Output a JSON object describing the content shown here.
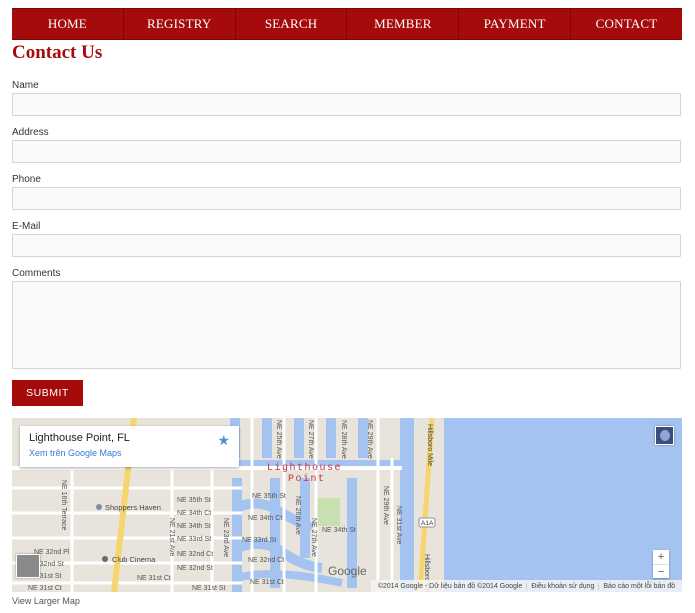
{
  "nav": {
    "items": [
      "HOME",
      "REGISTRY",
      "SEARCH",
      "MEMBER",
      "PAYMENT",
      "CONTACT"
    ]
  },
  "page_title": "Contact Us",
  "form": {
    "name_label": "Name",
    "address_label": "Address",
    "phone_label": "Phone",
    "email_label": "E-Mail",
    "comments_label": "Comments",
    "submit_label": "SUBMIT"
  },
  "map": {
    "card_title": "Lighthouse Point, FL",
    "card_link": "Xem trên Google Maps",
    "place_label_line1": "Lighthouse",
    "place_label_line2": "Point",
    "streets": {
      "ne_35th_st": "NE 35th St",
      "ne_34th_ct": "NE 34th Ct",
      "ne_34th_st": "NE 34th St",
      "ne_33rd_st": "NE 33rd St",
      "ne_32nd_ct": "NE 32nd Ct",
      "ne_32nd_st": "NE 32nd St",
      "ne_31st_ct": "NE 31st Ct",
      "ne_31st_st": "NE 31st St",
      "ne_32nd_pl": "NE 32nd Pl",
      "ne_16th_terrace": "NE 16th Terrace",
      "ne_21st_ave": "NE 21st Ave",
      "ne_23rd_ave": "NE 23rd Ave",
      "ne_25th_ave": "NE 25th Ave",
      "ne_26th_ave": "NE 26th Ave",
      "ne_27th_ave": "NE 27th Ave",
      "ne_28th_ave": "NE 28th Ave",
      "ne_29th_ave": "NE 29th Ave",
      "ne_31st_ave": "NE 31st Ave",
      "hillsboro_mile": "Hillsboro Mile",
      "a1a": "A1A"
    },
    "poi_shoppers_haven": "Shoppers Haven",
    "poi_club_cinema": "Club Cinema",
    "google_logo": "Google",
    "footer_copyright": "©2014 Google - Dữ liệu bản đồ ©2014 Google",
    "footer_terms": "Điều khoản sử dụng",
    "footer_report": "Báo cáo một lỗi bản đồ",
    "zoom_in": "+",
    "zoom_out": "−"
  },
  "larger_map_link": "View Larger Map",
  "colors": {
    "brand_red": "#a60b0b",
    "water": "#a5c3f1",
    "land": "#e8e4dc",
    "road_major": "#f7d56e"
  }
}
